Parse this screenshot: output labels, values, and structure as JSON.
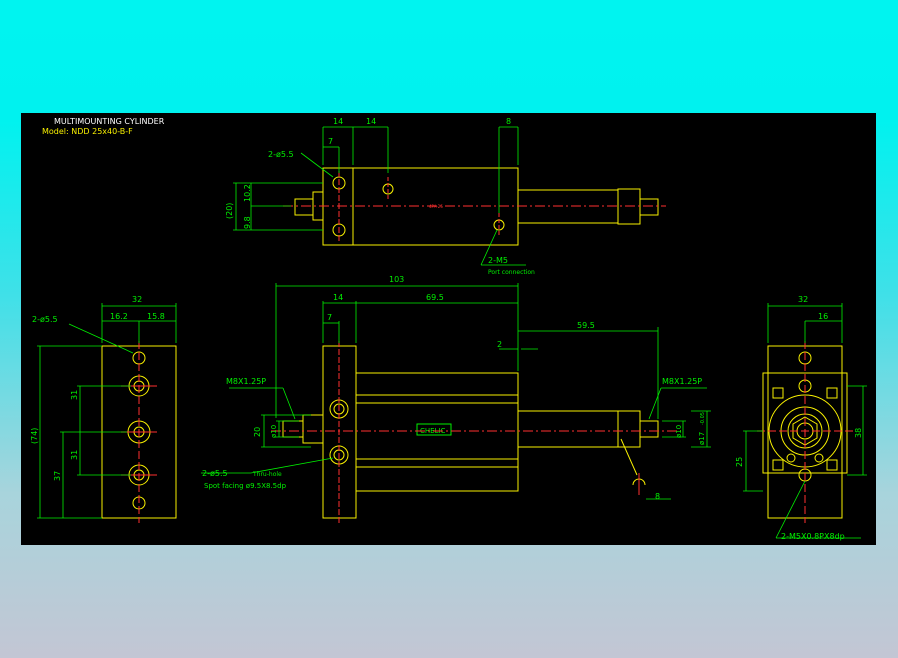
{
  "drawing": {
    "title": "MULTIMOUNTING CYLINDER",
    "model": "Model: NDD 25x40-B-F",
    "colors": {
      "background": "#000000",
      "outline": "#f8f000",
      "dimension": "#00f000",
      "centerline": "#ff3030",
      "title": "#ffffff"
    }
  },
  "top_view": {
    "dims": {
      "d14a": "14",
      "d14b": "14",
      "d8": "8",
      "d7": "7",
      "d20": "(20)",
      "d10_2": "10.2",
      "d9_8": "9.8"
    },
    "hole_note": "2-ø5.5",
    "port_note": "2-M5",
    "port_sub": "Port connection",
    "rod_tag": "4PA-25"
  },
  "side_view": {
    "dims": {
      "d32": "32",
      "d16_2": "16.2",
      "d15_8": "15.8",
      "d74": "(74)",
      "d31a": "31",
      "d31b": "31",
      "d37": "37"
    },
    "hole_note": "2-ø5.5"
  },
  "front_view": {
    "dims": {
      "d103": "103",
      "d14": "14",
      "d69_5": "69.5",
      "d7": "7",
      "d59_5": "59.5",
      "d2": "2",
      "d20": "20",
      "d_phi10a": "ø10",
      "d_phi10b": "ø10",
      "d_phi17": "ø17",
      "d_phi17_tol": "-0.05",
      "d8": "8"
    },
    "thread_left": "M8X1.25P",
    "thread_right": "M8X1.25P",
    "hole_note": "2-ø5.5",
    "hole_thru": "Thru-hole",
    "spot_facing": "Spot facing  ø9.5X8.5dp",
    "brand": "CHELIC"
  },
  "end_view": {
    "dims": {
      "d32": "32",
      "d16": "16",
      "d38": "38",
      "d25": "25"
    },
    "thread_note": "2-M5X0.8PX8dp"
  }
}
